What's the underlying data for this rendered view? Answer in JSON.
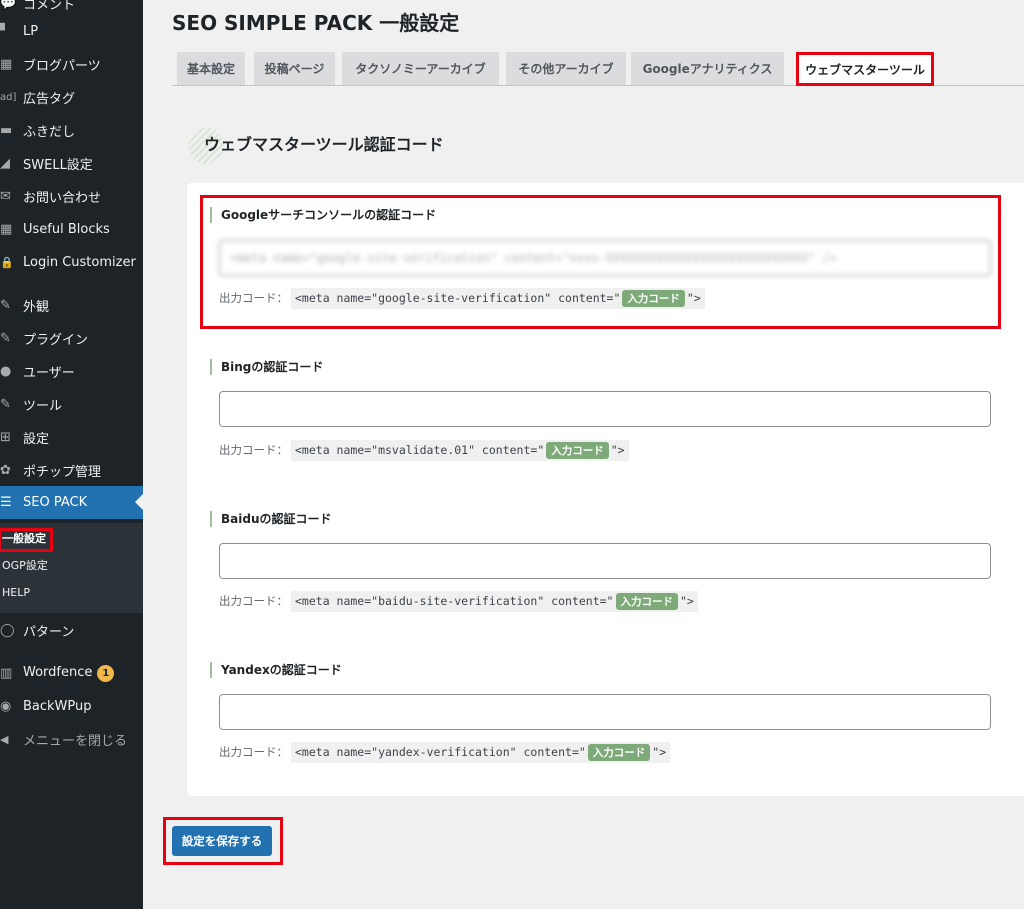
{
  "sidebar": {
    "items": [
      {
        "name": "comments",
        "label": "コメント",
        "icon": "comment-icon",
        "glyph": "💬"
      },
      {
        "name": "lp",
        "label": "LP",
        "icon": "page-icon",
        "glyph": "▘"
      },
      {
        "name": "blog-parts",
        "label": "ブログパーツ",
        "icon": "grid-icon",
        "glyph": "▦"
      },
      {
        "name": "ad-tag",
        "label": "広告タグ",
        "icon": "ad-icon",
        "glyph": "ad]"
      },
      {
        "name": "fukidashi",
        "label": "ふきだし",
        "icon": "speech-bubble-icon",
        "glyph": "▬"
      },
      {
        "name": "swell-settings",
        "label": "SWELL設定",
        "icon": "swell-icon",
        "glyph": "◢"
      },
      {
        "name": "contact",
        "label": "お問い合わせ",
        "icon": "mail-icon",
        "glyph": "✉"
      },
      {
        "name": "useful-blocks",
        "label": "Useful Blocks",
        "icon": "blocks-icon",
        "glyph": "▦"
      },
      {
        "name": "login-customizer",
        "label": "Login Customizer",
        "icon": "lock-icon",
        "glyph": "🔒"
      },
      {
        "name": "appearance",
        "label": "外観",
        "icon": "brush-icon",
        "glyph": "✎"
      },
      {
        "name": "plugins",
        "label": "プラグイン",
        "icon": "plugin-icon",
        "glyph": "✎"
      },
      {
        "name": "users",
        "label": "ユーザー",
        "icon": "user-icon",
        "glyph": "●"
      },
      {
        "name": "tools",
        "label": "ツール",
        "icon": "wrench-icon",
        "glyph": "✎"
      },
      {
        "name": "settings",
        "label": "設定",
        "icon": "settings-icon",
        "glyph": "⊞"
      },
      {
        "name": "pochipp",
        "label": "ポチップ管理",
        "icon": "paw-icon",
        "glyph": "✿"
      },
      {
        "name": "seo-pack",
        "label": "SEO PACK",
        "icon": "list-icon",
        "glyph": "☰"
      },
      {
        "name": "patterns",
        "label": "パターン",
        "icon": "circle-icon",
        "glyph": "◯"
      },
      {
        "name": "wordfence",
        "label": "Wordfence",
        "icon": "wordfence-icon",
        "glyph": "▥",
        "badge": "1"
      },
      {
        "name": "backwpup",
        "label": "BackWPup",
        "icon": "backwpup-icon",
        "glyph": "◉"
      },
      {
        "name": "close-menu",
        "label": "メニューを閉じる",
        "icon": "collapse-icon",
        "glyph": "◀"
      }
    ],
    "submenu": [
      "一般設定",
      "OGP設定",
      "HELP"
    ]
  },
  "page": {
    "title": "SEO SIMPLE PACK 一般設定"
  },
  "tabs": [
    "基本設定",
    "投稿ページ",
    "タクソノミーアーカイブ",
    "その他アーカイブ",
    "Googleアナリティクス",
    "ウェブマスターツール"
  ],
  "section": {
    "title": "ウェブマスターツール認証コード"
  },
  "fields": [
    {
      "label": "Googleサーチコンソールの認証コード",
      "value": "<meta name=\"google-site-verification\" content=\"xxxx-XXXXXXXXXXXXXXXXXXXXXXXXXXXX\" />",
      "code_prefix": "出力コード：",
      "code_before": "<meta name=\"google-site-verification\" content=\"",
      "code_tag": "入力コード",
      "code_after": "\">"
    },
    {
      "label": "Bingの認証コード",
      "value": "",
      "code_prefix": "出力コード：",
      "code_before": "<meta name=\"msvalidate.01\" content=\"",
      "code_tag": "入力コード",
      "code_after": "\">"
    },
    {
      "label": "Baiduの認証コード",
      "value": "",
      "code_prefix": "出力コード：",
      "code_before": "<meta name=\"baidu-site-verification\" content=\"",
      "code_tag": "入力コード",
      "code_after": "\">"
    },
    {
      "label": "Yandexの認証コード",
      "value": "",
      "code_prefix": "出力コード：",
      "code_before": "<meta name=\"yandex-verification\" content=\"",
      "code_tag": "入力コード",
      "code_after": "\">"
    }
  ],
  "save_button": "設定を保存する",
  "colors": {
    "sidebar_bg": "#1d2327",
    "accent": "#2271b1",
    "highlight_box": "#e60012",
    "code_tag": "#7eaa79"
  }
}
